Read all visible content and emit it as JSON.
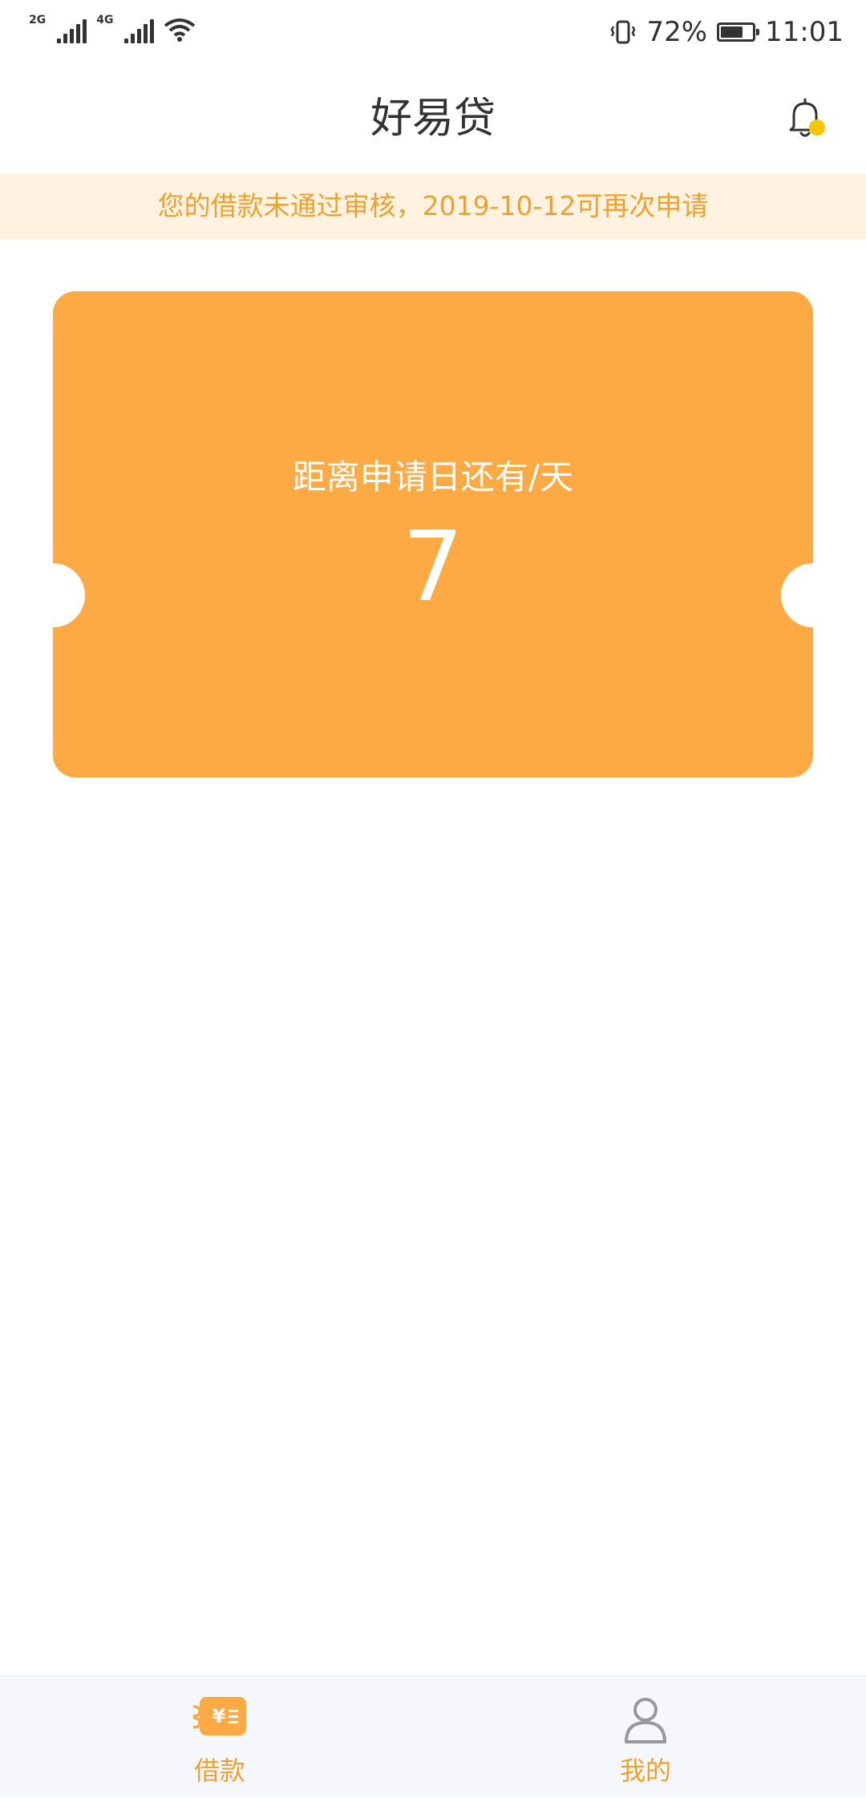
{
  "status_bar": {
    "net1": "2G",
    "net2": "4G",
    "battery_percent": "72%",
    "battery_level": 0.72,
    "time": "11:01"
  },
  "header": {
    "title": "好易贷",
    "bell_icon": "bell-icon"
  },
  "notice": {
    "text": "您的借款未通过审核，2019-10-12可再次申请"
  },
  "card": {
    "label": "距离申请日还有/天",
    "days": "7"
  },
  "tabbar": {
    "tabs": [
      {
        "label": "借款",
        "icon": "loan-icon",
        "active": true
      },
      {
        "label": "我的",
        "icon": "user-icon",
        "active": false
      }
    ]
  },
  "colors": {
    "accent": "#fdaa44",
    "accent_text": "#f0a02e",
    "notice_bg": "#fff2e1",
    "bell_dot": "#f7c600",
    "inactive_icon": "#999999"
  }
}
